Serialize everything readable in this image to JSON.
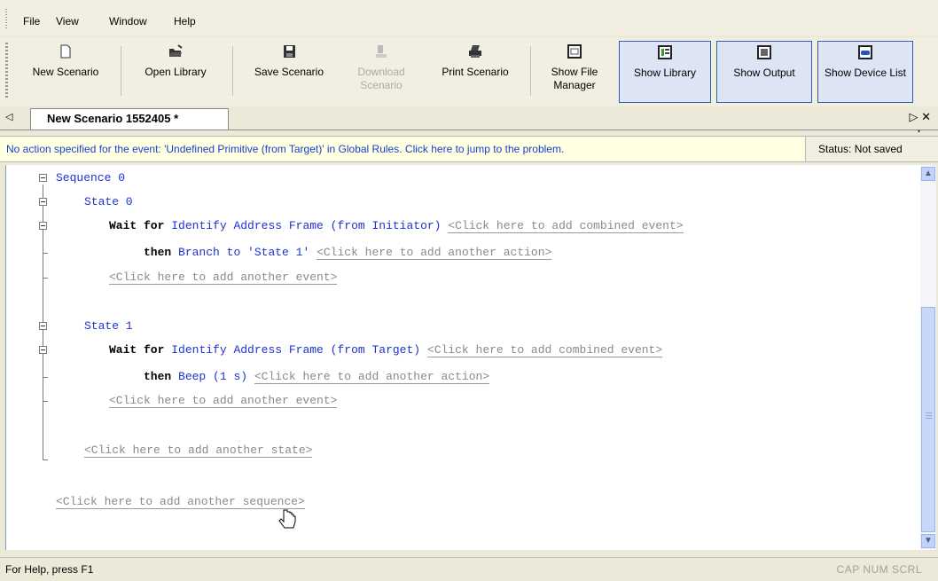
{
  "menu": {
    "file": "File",
    "view": "View",
    "window": "Window",
    "help": "Help"
  },
  "toolbar": {
    "new_scenario": "New Scenario",
    "open_library": "Open Library",
    "save_scenario": "Save Scenario",
    "download_scenario": "Download Scenario",
    "print_scenario": "Print Scenario",
    "show_file_manager": "Show File Manager",
    "show_library": "Show Library",
    "show_output": "Show Output",
    "show_device_list": "Show Device List"
  },
  "tab": {
    "title": "New Scenario 1552405 *"
  },
  "notice": {
    "message": "No action specified for the event: 'Undefined Primitive (from Target)' in Global Rules.  Click here to jump to the problem.",
    "status": "Status: Not saved"
  },
  "editor": {
    "sequence": "Sequence 0",
    "state0": "State 0",
    "wait_for": "Wait for",
    "then": "then",
    "event0": "Identify Address Frame (from Initiator)",
    "action0": "Branch to 'State 1'",
    "state1": "State 1",
    "event1": "Identify Address Frame (from Target)",
    "action1": "Beep (1 s)",
    "add_combined_event": "<Click here to add combined event>",
    "add_action": "<Click here to add another action>",
    "add_event": "<Click here to add another event>",
    "add_state": "<Click here to add another state>",
    "add_sequence": "<Click here to add another sequence>"
  },
  "statusbar": {
    "help": "For Help, press F1",
    "keys": "CAP  NUM  SCRL"
  },
  "colors": {
    "keyword": "#1e32d0",
    "notice_bg": "#ffffe1",
    "active_button": "#dde4f4"
  }
}
